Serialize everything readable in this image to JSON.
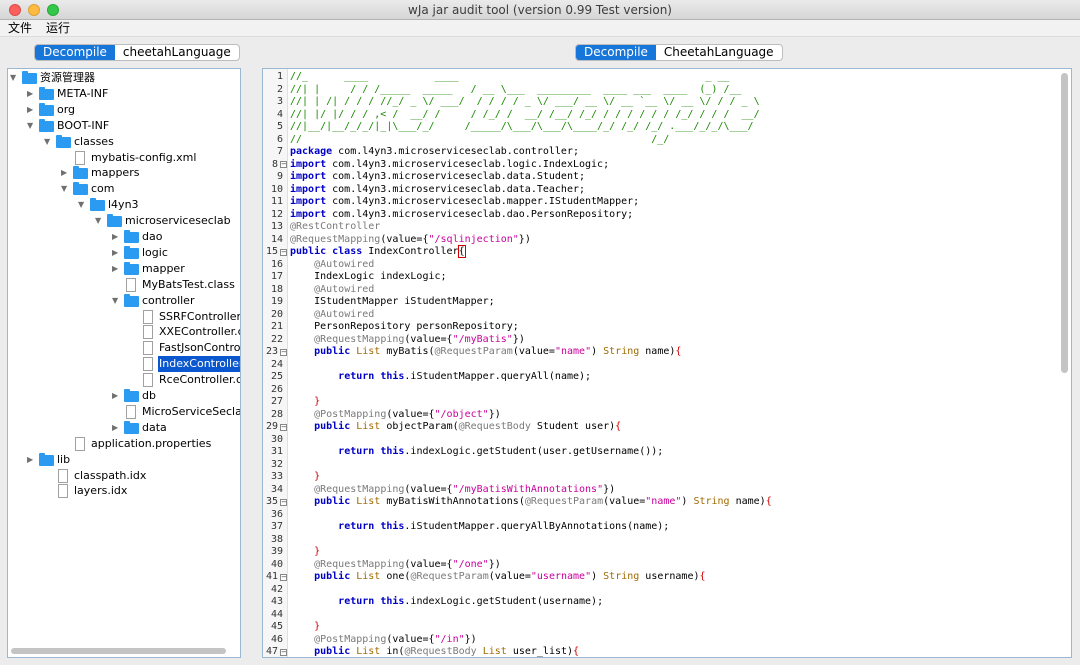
{
  "window": {
    "title": "wJa jar audit tool (version 0.99 Test version)"
  },
  "menu": {
    "file": "文件",
    "run": "运行"
  },
  "left_tabs": [
    "Decompile",
    "cheetahLanguage"
  ],
  "right_tabs": [
    "Decompile",
    "CheetahLanguage"
  ],
  "tree": [
    {
      "label": "资源管理器",
      "kind": "folder",
      "depth": 0,
      "arrow": "open"
    },
    {
      "label": "META-INF",
      "kind": "folder",
      "depth": 1,
      "arrow": "closed"
    },
    {
      "label": "org",
      "kind": "folder",
      "depth": 1,
      "arrow": "closed"
    },
    {
      "label": "BOOT-INF",
      "kind": "folder",
      "depth": 1,
      "arrow": "open"
    },
    {
      "label": "classes",
      "kind": "folder",
      "depth": 2,
      "arrow": "open"
    },
    {
      "label": "mybatis-config.xml",
      "kind": "file",
      "depth": 3
    },
    {
      "label": "mappers",
      "kind": "folder",
      "depth": 3,
      "arrow": "closed"
    },
    {
      "label": "com",
      "kind": "folder",
      "depth": 3,
      "arrow": "open"
    },
    {
      "label": "l4yn3",
      "kind": "folder",
      "depth": 4,
      "arrow": "open"
    },
    {
      "label": "microserviceseclab",
      "kind": "folder",
      "depth": 5,
      "arrow": "open"
    },
    {
      "label": "dao",
      "kind": "folder",
      "depth": 6,
      "arrow": "closed"
    },
    {
      "label": "logic",
      "kind": "folder",
      "depth": 6,
      "arrow": "closed"
    },
    {
      "label": "mapper",
      "kind": "folder",
      "depth": 6,
      "arrow": "closed"
    },
    {
      "label": "MyBatsTest.class",
      "kind": "file",
      "depth": 6
    },
    {
      "label": "controller",
      "kind": "folder",
      "depth": 6,
      "arrow": "open"
    },
    {
      "label": "SSRFController.class",
      "kind": "file",
      "depth": 7
    },
    {
      "label": "XXEController.class",
      "kind": "file",
      "depth": 7
    },
    {
      "label": "FastJsonController.cl",
      "kind": "file",
      "depth": 7
    },
    {
      "label": "IndexController.clas",
      "kind": "file",
      "depth": 7,
      "selected": true
    },
    {
      "label": "RceController.class",
      "kind": "file",
      "depth": 7
    },
    {
      "label": "db",
      "kind": "folder",
      "depth": 6,
      "arrow": "closed"
    },
    {
      "label": "MicroServiceSeclabAppl",
      "kind": "file",
      "depth": 6
    },
    {
      "label": "data",
      "kind": "folder",
      "depth": 6,
      "arrow": "closed"
    },
    {
      "label": "application.properties",
      "kind": "file",
      "depth": 3
    },
    {
      "label": "lib",
      "kind": "folder",
      "depth": 1,
      "arrow": "closed"
    },
    {
      "label": "classpath.idx",
      "kind": "file",
      "depth": 2
    },
    {
      "label": "layers.idx",
      "kind": "file",
      "depth": 2
    }
  ],
  "code": [
    [
      [
        "ascii",
        "//_      ____           ____                                         _ __"
      ]
    ],
    [
      [
        "ascii",
        "//| |     / / /_____  _____   / __ \\___  _________  ____ ___  ____  (_) /__"
      ]
    ],
    [
      [
        "ascii",
        "//| | /| / / / //_/ _ \\/ ___/  / / / / _ \\/ ___/ __ \\/ __ `__ \\/ __ \\/ / / _ \\"
      ]
    ],
    [
      [
        "ascii",
        "//| |/ |/ / / ,< /  __/ /     / /_/ /  __/ /__/ /_/ / / / / / / /_/ / / /  __/"
      ]
    ],
    [
      [
        "ascii",
        "//|__/|__/_/_/|_|\\___/_/     /_____/\\___/\\___/\\____/_/ /_/ /_/ .___/_/_/\\___/"
      ]
    ],
    [
      [
        "ascii",
        "//                                                          /_/"
      ]
    ],
    [
      [
        "kw",
        "package"
      ],
      [
        "",
        " com.l4yn3.microserviceseclab.controller;"
      ]
    ],
    [
      [
        "kw",
        "import"
      ],
      [
        "",
        " com.l4yn3.microserviceseclab.logic.IndexLogic;"
      ]
    ],
    [
      [
        "kw",
        "import"
      ],
      [
        "",
        " com.l4yn3.microserviceseclab.data.Student;"
      ]
    ],
    [
      [
        "kw",
        "import"
      ],
      [
        "",
        " com.l4yn3.microserviceseclab.data.Teacher;"
      ]
    ],
    [
      [
        "kw",
        "import"
      ],
      [
        "",
        " com.l4yn3.microserviceseclab.mapper.IStudentMapper;"
      ]
    ],
    [
      [
        "kw",
        "import"
      ],
      [
        "",
        " com.l4yn3.microserviceseclab.dao.PersonRepository;"
      ]
    ],
    [
      [
        "an",
        "@RestController"
      ]
    ],
    [
      [
        "an",
        "@RequestMapping"
      ],
      [
        "",
        "(value={"
      ],
      [
        "st",
        "\"/sqlinjection\""
      ],
      [
        "",
        "})"
      ]
    ],
    [
      [
        "kw",
        "public class"
      ],
      [
        "",
        " IndexController"
      ],
      [
        "cursor",
        "{"
      ]
    ],
    [
      [
        "",
        "    "
      ],
      [
        "an",
        "@Autowired"
      ]
    ],
    [
      [
        "",
        "    IndexLogic indexLogic;"
      ]
    ],
    [
      [
        "",
        "    "
      ],
      [
        "an",
        "@Autowired"
      ]
    ],
    [
      [
        "",
        "    IStudentMapper iStudentMapper;"
      ]
    ],
    [
      [
        "",
        "    "
      ],
      [
        "an",
        "@Autowired"
      ]
    ],
    [
      [
        "",
        "    PersonRepository personRepository;"
      ]
    ],
    [
      [
        "",
        "    "
      ],
      [
        "an",
        "@RequestMapping"
      ],
      [
        "",
        "(value={"
      ],
      [
        "st",
        "\"/myBatis\""
      ],
      [
        "",
        "})"
      ]
    ],
    [
      [
        "",
        "    "
      ],
      [
        "kw",
        "public"
      ],
      [
        "",
        " "
      ],
      [
        "ty",
        "List"
      ],
      [
        "",
        " myBatis("
      ],
      [
        "an",
        "@RequestParam"
      ],
      [
        "",
        "(value="
      ],
      [
        "st",
        "\"name\""
      ],
      [
        "",
        ") "
      ],
      [
        "ty",
        "String"
      ],
      [
        "",
        " name)"
      ],
      [
        "br",
        "{"
      ]
    ],
    [
      [
        "",
        ""
      ]
    ],
    [
      [
        "",
        "        "
      ],
      [
        "kw",
        "return this"
      ],
      [
        "",
        ".iStudentMapper.queryAll(name);"
      ]
    ],
    [
      [
        "",
        ""
      ]
    ],
    [
      [
        "",
        "    "
      ],
      [
        "br",
        "}"
      ]
    ],
    [
      [
        "",
        "    "
      ],
      [
        "an",
        "@PostMapping"
      ],
      [
        "",
        "(value={"
      ],
      [
        "st",
        "\"/object\""
      ],
      [
        "",
        "})"
      ]
    ],
    [
      [
        "",
        "    "
      ],
      [
        "kw",
        "public"
      ],
      [
        "",
        " "
      ],
      [
        "ty",
        "List"
      ],
      [
        "",
        " objectParam("
      ],
      [
        "an",
        "@RequestBody"
      ],
      [
        "",
        " Student user)"
      ],
      [
        "br",
        "{"
      ]
    ],
    [
      [
        "",
        ""
      ]
    ],
    [
      [
        "",
        "        "
      ],
      [
        "kw",
        "return this"
      ],
      [
        "",
        ".indexLogic.getStudent(user.getUsername());"
      ]
    ],
    [
      [
        "",
        ""
      ]
    ],
    [
      [
        "",
        "    "
      ],
      [
        "br",
        "}"
      ]
    ],
    [
      [
        "",
        "    "
      ],
      [
        "an",
        "@RequestMapping"
      ],
      [
        "",
        "(value={"
      ],
      [
        "st",
        "\"/myBatisWithAnnotations\""
      ],
      [
        "",
        "})"
      ]
    ],
    [
      [
        "",
        "    "
      ],
      [
        "kw",
        "public"
      ],
      [
        "",
        " "
      ],
      [
        "ty",
        "List"
      ],
      [
        "",
        " myBatisWithAnnotations("
      ],
      [
        "an",
        "@RequestParam"
      ],
      [
        "",
        "(value="
      ],
      [
        "st",
        "\"name\""
      ],
      [
        "",
        ") "
      ],
      [
        "ty",
        "String"
      ],
      [
        "",
        " name)"
      ],
      [
        "br",
        "{"
      ]
    ],
    [
      [
        "",
        ""
      ]
    ],
    [
      [
        "",
        "        "
      ],
      [
        "kw",
        "return this"
      ],
      [
        "",
        ".iStudentMapper.queryAllByAnnotations(name);"
      ]
    ],
    [
      [
        "",
        ""
      ]
    ],
    [
      [
        "",
        "    "
      ],
      [
        "br",
        "}"
      ]
    ],
    [
      [
        "",
        "    "
      ],
      [
        "an",
        "@RequestMapping"
      ],
      [
        "",
        "(value={"
      ],
      [
        "st",
        "\"/one\""
      ],
      [
        "",
        "})"
      ]
    ],
    [
      [
        "",
        "    "
      ],
      [
        "kw",
        "public"
      ],
      [
        "",
        " "
      ],
      [
        "ty",
        "List"
      ],
      [
        "",
        " one("
      ],
      [
        "an",
        "@RequestParam"
      ],
      [
        "",
        "(value="
      ],
      [
        "st",
        "\"username\""
      ],
      [
        "",
        ") "
      ],
      [
        "ty",
        "String"
      ],
      [
        "",
        " username)"
      ],
      [
        "br",
        "{"
      ]
    ],
    [
      [
        "",
        ""
      ]
    ],
    [
      [
        "",
        "        "
      ],
      [
        "kw",
        "return this"
      ],
      [
        "",
        ".indexLogic.getStudent(username);"
      ]
    ],
    [
      [
        "",
        ""
      ]
    ],
    [
      [
        "",
        "    "
      ],
      [
        "br",
        "}"
      ]
    ],
    [
      [
        "",
        "    "
      ],
      [
        "an",
        "@PostMapping"
      ],
      [
        "",
        "(value={"
      ],
      [
        "st",
        "\"/in\""
      ],
      [
        "",
        "})"
      ]
    ],
    [
      [
        "",
        "    "
      ],
      [
        "kw",
        "public"
      ],
      [
        "",
        " "
      ],
      [
        "ty",
        "List"
      ],
      [
        "",
        " in("
      ],
      [
        "an",
        "@RequestBody"
      ],
      [
        "",
        " "
      ],
      [
        "ty",
        "List"
      ],
      [
        "",
        " user_list)"
      ],
      [
        "br",
        "{"
      ]
    ]
  ],
  "fold_lines": [
    8,
    15,
    23,
    29,
    35,
    41,
    47
  ]
}
